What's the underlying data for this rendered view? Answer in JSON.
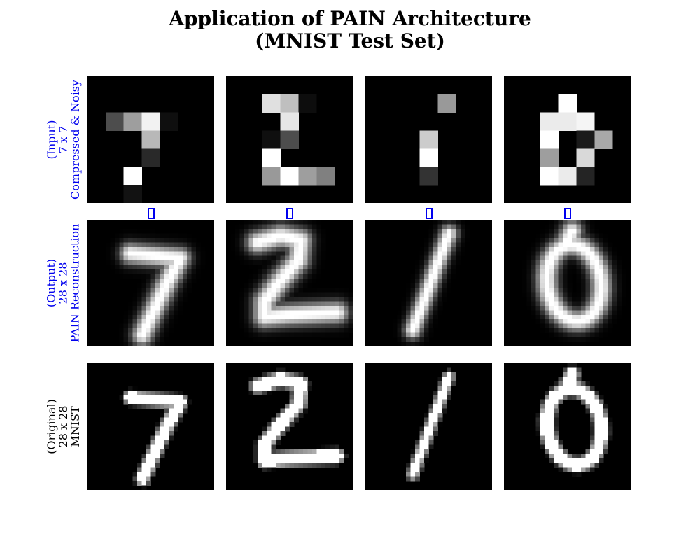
{
  "chart_data": {
    "type": "image-grid",
    "title_lines": [
      "Application of PAIN Architecture",
      "(MNIST Test Set)"
    ],
    "colors": {
      "highlight_label": "#0000ee",
      "plain_label": "#000000",
      "arrow": "#0000ee"
    },
    "columns": [
      "7",
      "2",
      "1",
      "0"
    ],
    "rows": [
      {
        "key": "input",
        "label_lines": [
          "(Input)",
          "7 x 7",
          "Compressed & Noisy"
        ],
        "color": "#0000ee",
        "resolution": "7x7"
      },
      {
        "key": "output",
        "label_lines": [
          "(Output)",
          "28 x 28",
          "PAIN Reconstruction"
        ],
        "color": "#0000ee",
        "resolution": "28x28"
      },
      {
        "key": "original",
        "label_lines": [
          "(Original)",
          "28 x 28",
          "MNIST"
        ],
        "color": "#000000",
        "resolution": "28x28"
      }
    ],
    "input_grids": [
      [
        [
          0,
          0,
          0,
          0,
          0,
          0,
          0
        ],
        [
          0,
          0,
          0,
          0,
          0,
          0,
          0
        ],
        [
          0,
          0.3,
          0.62,
          0.95,
          0.06,
          0,
          0
        ],
        [
          0,
          0,
          0,
          0.72,
          0,
          0,
          0
        ],
        [
          0,
          0,
          0,
          0.16,
          0,
          0,
          0
        ],
        [
          0,
          0,
          1.0,
          0,
          0,
          0,
          0
        ],
        [
          0,
          0,
          0.07,
          0,
          0,
          0,
          0
        ]
      ],
      [
        [
          0,
          0,
          0,
          0,
          0,
          0,
          0
        ],
        [
          0,
          0,
          0.88,
          0.75,
          0.05,
          0,
          0
        ],
        [
          0,
          0,
          0,
          0.9,
          0,
          0,
          0
        ],
        [
          0,
          0,
          0.06,
          0.3,
          0,
          0,
          0
        ],
        [
          0,
          0,
          1.0,
          0,
          0,
          0,
          0
        ],
        [
          0,
          0,
          0.6,
          1.0,
          0.62,
          0.5,
          0
        ],
        [
          0,
          0,
          0,
          0,
          0,
          0,
          0
        ]
      ],
      [
        [
          0,
          0,
          0,
          0,
          0,
          0,
          0
        ],
        [
          0,
          0,
          0,
          0,
          0.6,
          0,
          0
        ],
        [
          0,
          0,
          0,
          0,
          0,
          0,
          0
        ],
        [
          0,
          0,
          0,
          0.8,
          0,
          0,
          0
        ],
        [
          0,
          0,
          0,
          1.0,
          0,
          0,
          0
        ],
        [
          0,
          0,
          0,
          0.2,
          0,
          0,
          0
        ],
        [
          0,
          0,
          0,
          0,
          0,
          0,
          0
        ]
      ],
      [
        [
          0,
          0,
          0,
          0,
          0,
          0,
          0
        ],
        [
          0,
          0,
          0,
          1.0,
          0,
          0,
          0
        ],
        [
          0,
          0,
          0.92,
          0.92,
          0.96,
          0,
          0
        ],
        [
          0,
          0,
          1.0,
          0,
          0.1,
          0.66,
          0
        ],
        [
          0,
          0,
          0.62,
          0,
          0.85,
          0,
          0
        ],
        [
          0,
          0,
          1.0,
          0.92,
          0.14,
          0,
          0
        ],
        [
          0,
          0,
          0,
          0,
          0,
          0,
          0
        ]
      ]
    ],
    "arrows": [
      "down-arrow",
      "down-arrow",
      "down-arrow",
      "down-arrow"
    ]
  }
}
